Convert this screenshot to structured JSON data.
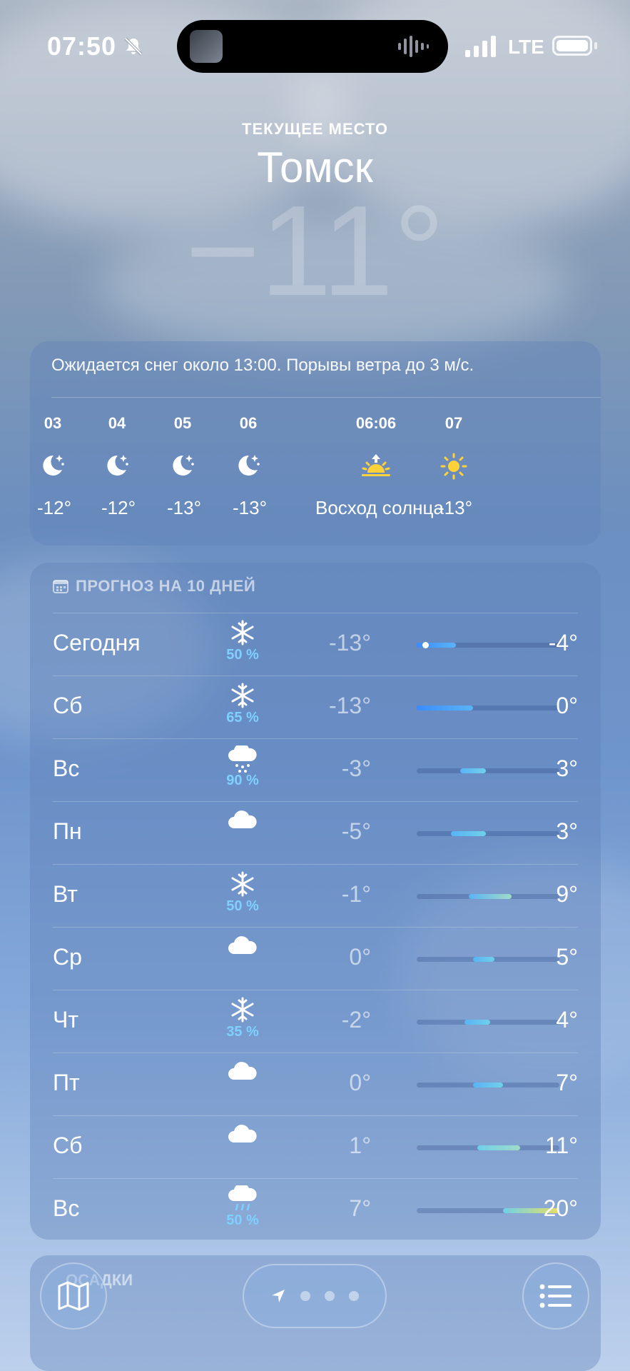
{
  "status_bar": {
    "time": "07:50",
    "network": "LTE"
  },
  "header": {
    "location_label": "ТЕКУЩЕЕ МЕСТО",
    "city": "Томск",
    "current_temp": "−11°"
  },
  "hourly": {
    "summary": "Ожидается снег около 13:00. Порывы ветра до 3 м/с.",
    "items": [
      {
        "time": "03",
        "icon": "moon-stars-icon",
        "temp": "-12°"
      },
      {
        "time": "04",
        "icon": "moon-stars-icon",
        "temp": "-12°"
      },
      {
        "time": "05",
        "icon": "moon-stars-icon",
        "temp": "-13°"
      },
      {
        "time": "06",
        "icon": "moon-stars-icon",
        "temp": "-13°"
      },
      {
        "time": "06:06",
        "icon": "sunrise-icon",
        "temp": "Восход солнца"
      },
      {
        "time": "07",
        "icon": "sun-icon",
        "temp": "-13°"
      }
    ]
  },
  "forecast": {
    "title": "ПРОГНОЗ НА 10 ДНЕЙ",
    "range_min": -13,
    "range_max": 20,
    "days": [
      {
        "day": "Сегодня",
        "icon": "snowflake-icon",
        "precip": "50 %",
        "low": "-13°",
        "high": "-4°",
        "low_val": -13,
        "high_val": -4,
        "current": -11
      },
      {
        "day": "Сб",
        "icon": "snowflake-icon",
        "precip": "65 %",
        "low": "-13°",
        "high": "0°",
        "low_val": -13,
        "high_val": 0
      },
      {
        "day": "Вс",
        "icon": "cloud-snow-icon",
        "precip": "90 %",
        "low": "-3°",
        "high": "3°",
        "low_val": -3,
        "high_val": 3
      },
      {
        "day": "Пн",
        "icon": "cloud-icon",
        "precip": "",
        "low": "-5°",
        "high": "3°",
        "low_val": -5,
        "high_val": 3
      },
      {
        "day": "Вт",
        "icon": "snowflake-icon",
        "precip": "50 %",
        "low": "-1°",
        "high": "9°",
        "low_val": -1,
        "high_val": 9
      },
      {
        "day": "Ср",
        "icon": "cloud-icon",
        "precip": "",
        "low": "0°",
        "high": "5°",
        "low_val": 0,
        "high_val": 5
      },
      {
        "day": "Чт",
        "icon": "snowflake-icon",
        "precip": "35 %",
        "low": "-2°",
        "high": "4°",
        "low_val": -2,
        "high_val": 4
      },
      {
        "day": "Пт",
        "icon": "cloud-icon",
        "precip": "",
        "low": "0°",
        "high": "7°",
        "low_val": 0,
        "high_val": 7
      },
      {
        "day": "Сб",
        "icon": "cloud-icon",
        "precip": "",
        "low": "1°",
        "high": "11°",
        "low_val": 1,
        "high_val": 11
      },
      {
        "day": "Вс",
        "icon": "cloud-rain-icon",
        "precip": "50 %",
        "low": "7°",
        "high": "20°",
        "low_val": 7,
        "high_val": 20
      }
    ]
  },
  "next_section": {
    "title": "ОСАДКИ"
  },
  "colors": {
    "precip": "#7ed0ff",
    "sun": "#ffd23a"
  }
}
